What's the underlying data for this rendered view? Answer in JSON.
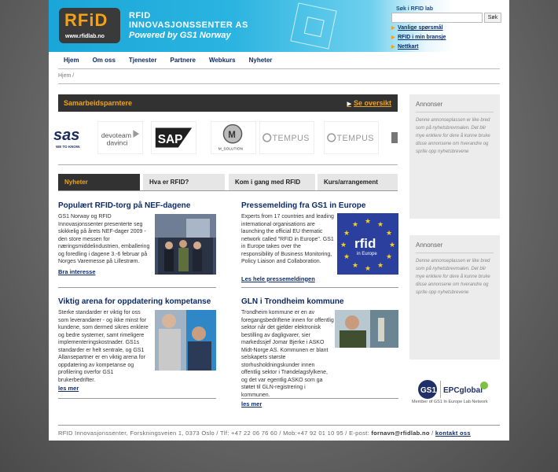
{
  "brand": {
    "logo_text": "RFiD",
    "logo_url": "www.rfidlab.no",
    "line1": "RFID",
    "line2": "INNOVASJONSSENTER AS",
    "line3": "Powered by GS1 Norway"
  },
  "search": {
    "label": "Søk i RFID lab",
    "button": "Søk",
    "value": ""
  },
  "quick_links": [
    "Vanlige spørsmål",
    "RFID i min bransje",
    "Nettkart"
  ],
  "nav": [
    "Hjem",
    "Om oss",
    "Tjenester",
    "Partnere",
    "Webkurs",
    "Nyheter"
  ],
  "breadcrumb": "Hjem /",
  "partners": {
    "title": "Samarbeidsparntere",
    "see_all": "Se oversikt",
    "logos": [
      "sas",
      "devoteam davinci",
      "SAP",
      "M_SOLUTION",
      "TEMPUS",
      "TEMPUS"
    ],
    "sas_tag": "WE TO KNOW."
  },
  "tabs": [
    "Nyheter",
    "Hva er RFID?",
    "Kom i gang med RFID",
    "Kurs/arrangement"
  ],
  "articles": [
    {
      "title": "Populært RFID-torg på NEF-dagene",
      "body": "GS1 Norway og RFID Innovasjonssenter presenterte seg skikkelig på årets NEF-dager 2009 - den store messen for næringsmiddelindustrien, emballering og foredling i dagene 3.-6 februar på Norges Varemesse på Lillestrøm.",
      "more": "Bra interesse"
    },
    {
      "title": "Pressemelding fra GS1 in Europe",
      "body": "Experts from 17 countries and leading international organisations are launching the official EU thematic network called \"RFID in Europe\". GS1 in Europe takes over the responsibility of Business Monitoring, Policy Liaison and Collaboration.",
      "more": "Les hele pressemeldingen",
      "badge_big": "rfid",
      "badge_small": "in Europe"
    },
    {
      "title": "Viktig arena for oppdatering kompetanse",
      "body": "Sterke standarder er viktig for oss som leverandører - og ikke minst for kundene, som dermed sikres enklere og bedre systemer, samt rimeligere implementeringskostnader. GS1s standarder er helt sentrale, og GS1 Allansepartner er en viktig arena for oppdatering av kompetanse og profilering overfor GS1 brukerbedrifter.",
      "more": "les mer"
    },
    {
      "title": "GLN i Trondheim kommune",
      "body": "Trondheim kommune er en av foregangsbedriftene innen for offentlig sektor når det gjelder elektronisk bestilling av dagligvarer, sier markedssjef Jomar Bjerke i ASKO Midt-Norge AS. Kommunen er blant selskapets største storhusholdningskunder innen offentlig sektor i Trøndelagsfylkene, og det var egentlig ASKO som ga støtet til GLN-registrering i kommunen.",
      "more": "les mer"
    }
  ],
  "ads": [
    {
      "title": "Annonser",
      "text": "Denne annonseplassen er like bred som på nyhetsbrevmalen. Det blir mye enklere for dere å kunne bruke disse annonsene om hverandre og sprite opp nyhetsbrevene"
    },
    {
      "title": "Annonser",
      "text": "Denne annonseplassen er like bred som på nyhetsbrevmalen. Det blir mye enklere for dere å kunne bruke disse annonsene om hverandre og sprite opp nyhetsbrevene"
    }
  ],
  "gs1": {
    "mark": "GS1",
    "epc": "EPCglobal",
    "caption": "Member of GS1 In Europe Lab Network"
  },
  "footer": {
    "address": "RFID Innovasjonssenter, Forskningsveien 1, 0373 Oslo / Tlf: +47 22 06 76 60 / Mob:+47 92 01 10 95 / E-post:",
    "email": "fornavn@rfidlab.no",
    "sep": "/",
    "contact": "kontakt oss"
  },
  "colors": {
    "accent": "#f2a21a",
    "link": "#0d2b66",
    "header_blue": "#1aa6d8",
    "dark_bar": "#323232"
  }
}
